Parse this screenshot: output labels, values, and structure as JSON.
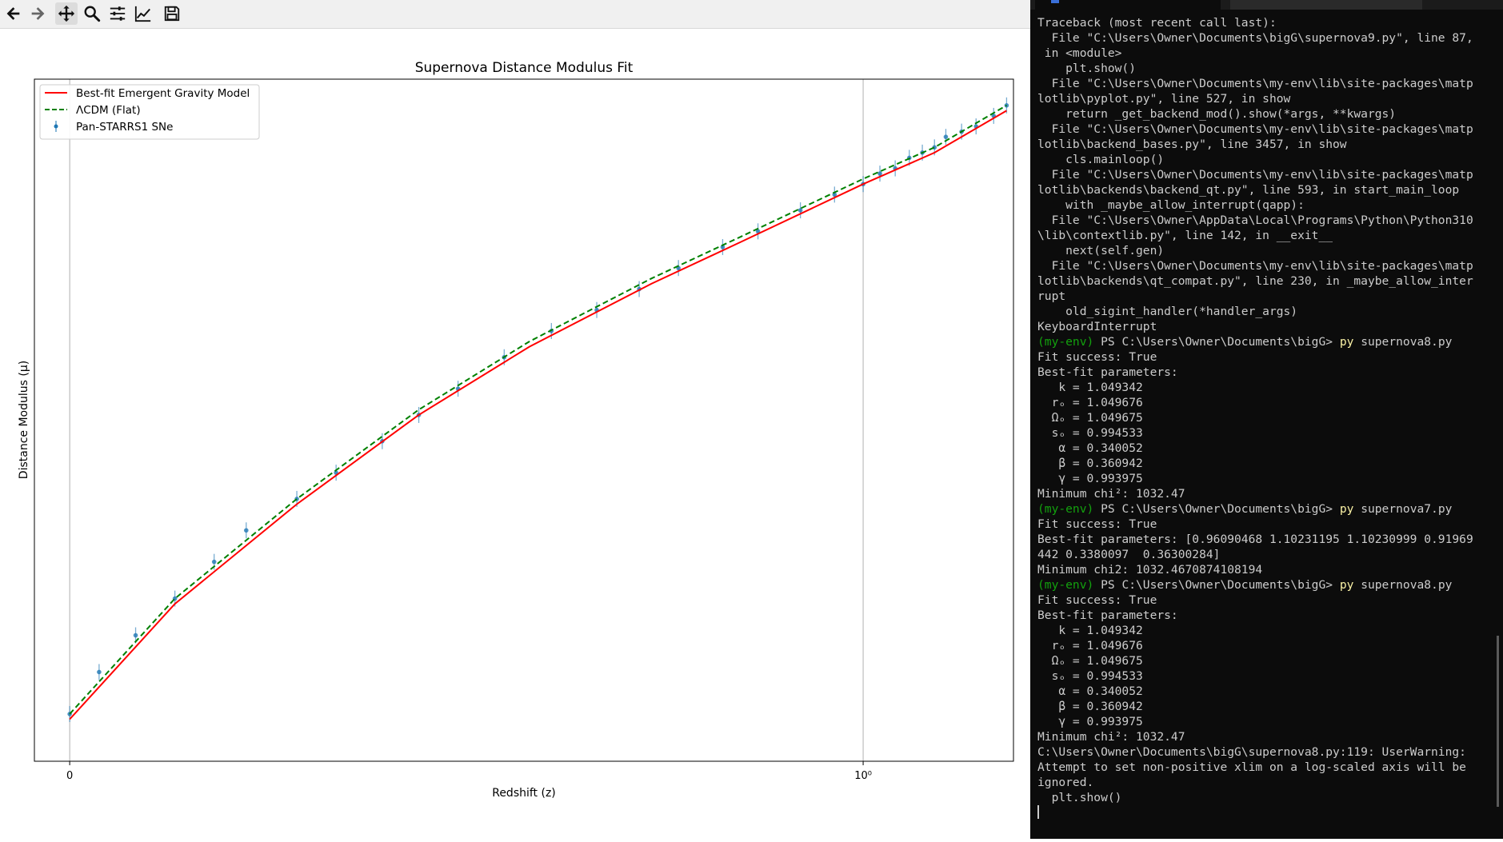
{
  "toolbar": {
    "buttons": [
      {
        "icon": "arrow-left-icon",
        "label": "Back"
      },
      {
        "icon": "arrow-right-icon",
        "label": "Forward"
      },
      {
        "icon": "move-icon",
        "label": "Pan"
      },
      {
        "icon": "magnifier-icon",
        "label": "Zoom"
      },
      {
        "icon": "sliders-icon",
        "label": "Configure subplots"
      },
      {
        "icon": "chart-line-icon",
        "label": "Edit axis"
      },
      {
        "icon": "floppy-disk-icon",
        "label": "Save"
      }
    ],
    "active_button": "move-icon"
  },
  "chart_data": {
    "type": "scatter",
    "title": "Supernova Distance Modulus Fit",
    "xlabel": "Redshift (z)",
    "ylabel": "Distance Modulus (μ)",
    "xscale": "log",
    "x_tick_labels": [
      "0",
      "10⁰"
    ],
    "xlim": [
      0.009,
      2.35
    ],
    "ylim": [
      33.5,
      46.5
    ],
    "grid": "vertical",
    "legend_position": "top-left",
    "legend": [
      {
        "label": "Best-fit Emergent Gravity Model",
        "color": "#ff0000",
        "style": "solid"
      },
      {
        "label": "ΛCDM (Flat)",
        "color": "#008000",
        "style": "dashed"
      },
      {
        "label": "Pan-STARRS1 SNe",
        "color": "#1f77b4",
        "style": "errorbar"
      }
    ],
    "series": [
      {
        "name": "Pan-STARRS1 SNe",
        "kind": "errorbar",
        "color": "#1f77b4",
        "x": [
          0.011,
          0.013,
          0.016,
          0.02,
          0.025,
          0.03,
          0.04,
          0.05,
          0.065,
          0.08,
          0.1,
          0.13,
          0.17,
          0.22,
          0.28,
          0.35,
          0.45,
          0.55,
          0.7,
          0.85,
          1.0,
          1.1,
          1.2,
          1.3,
          1.4,
          1.5,
          1.6,
          1.75,
          1.9,
          2.1,
          2.26
        ],
        "y": [
          34.4,
          35.2,
          35.9,
          36.6,
          37.3,
          37.9,
          38.5,
          39.0,
          39.6,
          40.1,
          40.6,
          41.2,
          41.7,
          42.1,
          42.5,
          42.9,
          43.3,
          43.6,
          44.0,
          44.3,
          44.5,
          44.7,
          44.8,
          45.0,
          45.1,
          45.2,
          45.4,
          45.5,
          45.6,
          45.8,
          46.0
        ]
      },
      {
        "name": "Best-fit Emergent Gravity Model",
        "kind": "line",
        "color": "#ff0000",
        "x": [
          0.011,
          0.02,
          0.04,
          0.08,
          0.15,
          0.3,
          0.5,
          1.0,
          1.5,
          2.26
        ],
        "y": [
          34.3,
          36.5,
          38.4,
          40.1,
          41.4,
          42.6,
          43.4,
          44.5,
          45.1,
          45.9
        ]
      },
      {
        "name": "ΛCDM (Flat)",
        "kind": "line",
        "color": "#008000",
        "x": [
          0.011,
          0.02,
          0.04,
          0.08,
          0.15,
          0.3,
          0.5,
          1.0,
          1.5,
          2.26
        ],
        "y": [
          34.4,
          36.6,
          38.5,
          40.2,
          41.5,
          42.7,
          43.5,
          44.6,
          45.2,
          46.0
        ]
      }
    ]
  },
  "terminal": {
    "lines": [
      {
        "t": "Traceback (most recent call last):"
      },
      {
        "t": "  File \"C:\\Users\\Owner\\Documents\\bigG\\supernova9.py\", line 87,"
      },
      {
        "t": " in <module>"
      },
      {
        "t": "    plt.show()"
      },
      {
        "t": "  File \"C:\\Users\\Owner\\Documents\\my-env\\lib\\site-packages\\matp"
      },
      {
        "t": "lotlib\\pyplot.py\", line 527, in show"
      },
      {
        "t": "    return _get_backend_mod().show(*args, **kwargs)"
      },
      {
        "t": "  File \"C:\\Users\\Owner\\Documents\\my-env\\lib\\site-packages\\matp"
      },
      {
        "t": "lotlib\\backend_bases.py\", line 3457, in show"
      },
      {
        "t": "    cls.mainloop()"
      },
      {
        "t": "  File \"C:\\Users\\Owner\\Documents\\my-env\\lib\\site-packages\\matp"
      },
      {
        "t": "lotlib\\backends\\backend_qt.py\", line 593, in start_main_loop"
      },
      {
        "t": "    with _maybe_allow_interrupt(qapp):"
      },
      {
        "t": "  File \"C:\\Users\\Owner\\AppData\\Local\\Programs\\Python\\Python310"
      },
      {
        "t": "\\lib\\contextlib.py\", line 142, in __exit__"
      },
      {
        "t": "    next(self.gen)"
      },
      {
        "t": "  File \"C:\\Users\\Owner\\Documents\\my-env\\lib\\site-packages\\matp"
      },
      {
        "t": "lotlib\\backends\\qt_compat.py\", line 230, in _maybe_allow_inter"
      },
      {
        "t": "rupt"
      },
      {
        "t": "    old_sigint_handler(*handler_args)"
      },
      {
        "t": "KeyboardInterrupt"
      },
      {
        "env": "(my-env)",
        "prompt": " PS C:\\Users\\Owner\\Documents\\bigG> ",
        "cmd": "py",
        "args": " supernova8.py"
      },
      {
        "t": "Fit success: True"
      },
      {
        "t": "Best-fit parameters:"
      },
      {
        "t": "   k = 1.049342"
      },
      {
        "t": "  rₒ = 1.049676"
      },
      {
        "t": "  Ωₒ = 1.049675"
      },
      {
        "t": "  sₒ = 0.994533"
      },
      {
        "t": "   α = 0.340052"
      },
      {
        "t": "   β = 0.360942"
      },
      {
        "t": "   γ = 0.993975"
      },
      {
        "t": "Minimum chi²: 1032.47"
      },
      {
        "env": "(my-env)",
        "prompt": " PS C:\\Users\\Owner\\Documents\\bigG> ",
        "cmd": "py",
        "args": " supernova7.py"
      },
      {
        "t": "Fit success: True"
      },
      {
        "t": "Best-fit parameters: [0.96090468 1.10231195 1.10230999 0.91969"
      },
      {
        "t": "442 0.3380097  0.36300284]"
      },
      {
        "t": "Minimum chi2: 1032.4670874108194"
      },
      {
        "env": "(my-env)",
        "prompt": " PS C:\\Users\\Owner\\Documents\\bigG> ",
        "cmd": "py",
        "args": " supernova8.py"
      },
      {
        "t": "Fit success: True"
      },
      {
        "t": "Best-fit parameters:"
      },
      {
        "t": "   k = 1.049342"
      },
      {
        "t": "  rₒ = 1.049676"
      },
      {
        "t": "  Ωₒ = 1.049675"
      },
      {
        "t": "  sₒ = 0.994533"
      },
      {
        "t": "   α = 0.340052"
      },
      {
        "t": "   β = 0.360942"
      },
      {
        "t": "   γ = 0.993975"
      },
      {
        "t": "Minimum chi²: 1032.47"
      },
      {
        "t": "C:\\Users\\Owner\\Documents\\bigG\\supernova8.py:119: UserWarning:"
      },
      {
        "t": "Attempt to set non-positive xlim on a log-scaled axis will be"
      },
      {
        "t": "ignored."
      },
      {
        "t": "  plt.show()"
      }
    ]
  }
}
